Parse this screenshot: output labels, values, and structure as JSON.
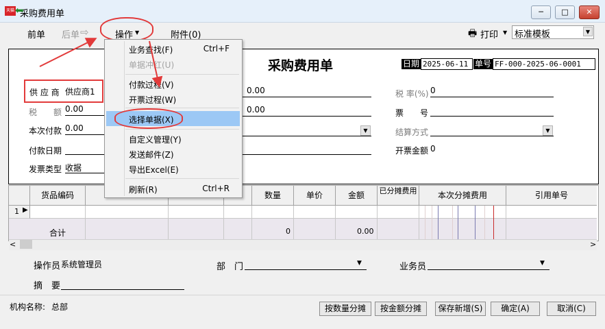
{
  "window": {
    "title": "采购费用单",
    "app_icon_text": "天猫",
    "controls": {
      "minimize": "─",
      "maximize": "□",
      "close": "✕"
    }
  },
  "toolbar": {
    "prev": "前单",
    "next": "后单",
    "operate": "操作",
    "attach": "附件(0)",
    "print": "打印",
    "template": "标准模板"
  },
  "header": {
    "form_title": "采购费用单",
    "date_label": "日期",
    "date_value": "2025-06-11",
    "no_label": "单号",
    "no_value": "FF-000-2025-06-0001"
  },
  "fields": {
    "supplier_label": "供 应 商",
    "supplier_value": "供应商1",
    "tax_label": "税　　额",
    "tax_value": "0.00",
    "pay_label": "本次付款",
    "pay_value": "0.00",
    "paydate_label": "付款日期",
    "invtype_label": "发票类型",
    "invtype_value": "收据",
    "mid1_value": "0.00",
    "mid2_value": "0.00",
    "taxrate_label": "税 率(%)",
    "taxrate_value": "0",
    "invno_label": "票　　号",
    "settle_label": "结算方式",
    "invamount_label": "开票金额",
    "invamount_value": "0"
  },
  "grid": {
    "columns": [
      "货品编码",
      "",
      "",
      "",
      "数量",
      "单价",
      "金额",
      "已分摊费用",
      "本次分摊费用",
      "引用单号"
    ],
    "row1_index": "1",
    "total_label": "合计",
    "total_qty": "0",
    "total_amount": "0.00"
  },
  "bottom": {
    "operator_label": "操作员",
    "operator_value": "系统管理员",
    "dept_label": "部　门",
    "salesman_label": "业务员",
    "remark_label": "摘　要",
    "org_label": "机构名称:",
    "org_value": "总部"
  },
  "buttons": {
    "by_qty": "按数量分摊",
    "by_amount": "按金额分摊",
    "save_new": "保存新增(S)",
    "ok": "确定(A)",
    "cancel": "取消(C)"
  },
  "menu": {
    "items": [
      {
        "label": "业务查找(F)",
        "shortcut": "Ctrl+F",
        "enabled": true
      },
      {
        "label": "单据冲红(U)",
        "shortcut": "",
        "enabled": false
      },
      {
        "label": "付款过程(V)",
        "shortcut": "",
        "enabled": true
      },
      {
        "label": "开票过程(W)",
        "shortcut": "",
        "enabled": true
      },
      {
        "label": "选择单据(X)",
        "shortcut": "",
        "enabled": true
      },
      {
        "label": "自定义管理(Y)",
        "shortcut": "",
        "enabled": true
      },
      {
        "label": "发送邮件(Z)",
        "shortcut": "",
        "enabled": true
      },
      {
        "label": "导出Excel(E)",
        "shortcut": "",
        "enabled": true
      },
      {
        "label": "刷新(R)",
        "shortcut": "Ctrl+R",
        "enabled": true
      }
    ]
  },
  "icons": {
    "prev": "arrow-left-icon",
    "next": "arrow-right-icon",
    "print": "printer-icon",
    "dropdown": "chevron-down-icon"
  },
  "colors": {
    "highlight": "#9cc8f5",
    "annotation": "#e23a3a",
    "titlebar": "#e6f0fa"
  }
}
